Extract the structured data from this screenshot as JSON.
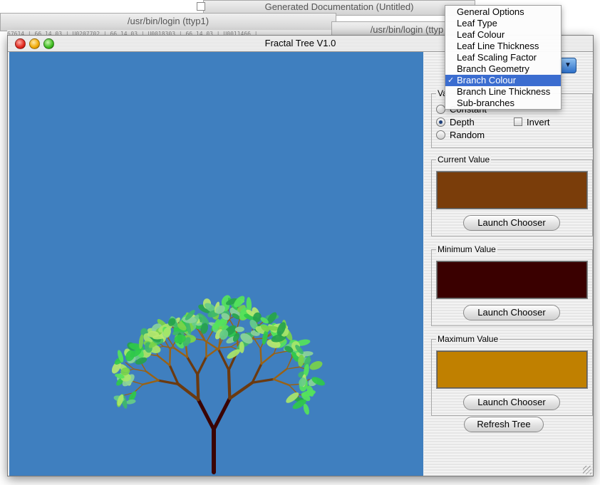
{
  "background_windows": {
    "doc_title": "Generated Documentation (Untitled)",
    "terminal1_title": "/usr/bin/login (ttyp1)",
    "terminal2_title": "/usr/bin/login (ttyp",
    "terminal_text": "67614 | 66 14 03 | U0207702 | 66 14 03 | U0018303 | 66 14 03 | U0011466 |"
  },
  "window": {
    "title": "Fractal Tree V1.0"
  },
  "menu": {
    "items": [
      {
        "label": "General Options",
        "selected": false
      },
      {
        "label": "Leaf Type",
        "selected": false
      },
      {
        "label": "Leaf Colour",
        "selected": false
      },
      {
        "label": "Leaf Line Thickness",
        "selected": false
      },
      {
        "label": "Leaf Scaling Factor",
        "selected": false
      },
      {
        "label": "Branch Geometry",
        "selected": false
      },
      {
        "label": "Branch Colour",
        "selected": true
      },
      {
        "label": "Branch Line Thickness",
        "selected": false
      },
      {
        "label": "Sub-branches",
        "selected": false
      }
    ],
    "check_glyph": "✓"
  },
  "panel": {
    "values_label": "Va",
    "radios": [
      {
        "label": "Constant",
        "checked": false
      },
      {
        "label": "Depth",
        "checked": true
      },
      {
        "label": "Random",
        "checked": false
      }
    ],
    "invert": {
      "label": "Invert",
      "checked": false
    },
    "current": {
      "label": "Current Value",
      "color": "#7a3d0a",
      "button": "Launch Chooser"
    },
    "minimum": {
      "label": "Minimum Value",
      "color": "#3a0000",
      "button": "Launch Chooser"
    },
    "maximum": {
      "label": "Maximum Value",
      "color": "#c08000",
      "button": "Launch Chooser"
    },
    "refresh_button": "Refresh Tree"
  },
  "colors": {
    "canvas_bg": "#3f7fbf",
    "menu_highlight": "#3b6dd0",
    "trunk": "#3a0404",
    "branch": "#6b3a10",
    "twig": "#9a6214"
  }
}
